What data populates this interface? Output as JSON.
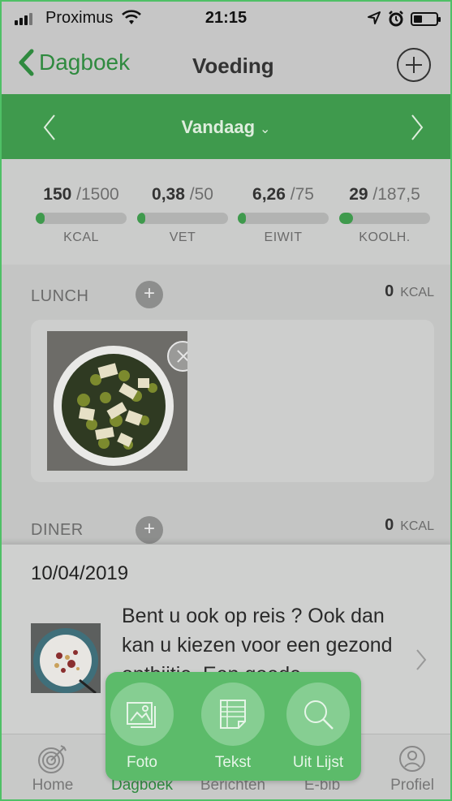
{
  "status_bar": {
    "carrier": "Proximus",
    "time": "21:15"
  },
  "nav": {
    "back_label": "Dagboek",
    "title": "Voeding"
  },
  "date_bar": {
    "label": "Vandaag"
  },
  "summary": [
    {
      "value": "150",
      "total": "/1500",
      "unit": "KCAL",
      "progress": 0.1
    },
    {
      "value": "0,38",
      "total": "/50",
      "unit": "VET",
      "progress": 0.01
    },
    {
      "value": "6,26",
      "total": "/75",
      "unit": "EIWIT",
      "progress": 0.08
    },
    {
      "value": "29",
      "total": "/187,5",
      "unit": "KOOLH.",
      "progress": 0.155
    }
  ],
  "meals": [
    {
      "name": "LUNCH",
      "kcal": "0",
      "unit": "KCAL"
    },
    {
      "name": "DINER",
      "kcal": "0",
      "unit": "KCAL"
    }
  ],
  "news": {
    "date": "10/04/2019",
    "text": "Bent u ook op reis ? Ook dan kan u kiezen voor een gezond ontbijtje. Een goede"
  },
  "popup_actions": [
    {
      "label": "Foto",
      "icon": "photo-icon"
    },
    {
      "label": "Tekst",
      "icon": "text-note-icon"
    },
    {
      "label": "Uit Lijst",
      "icon": "search-icon"
    }
  ],
  "tabs": [
    {
      "label": "Home",
      "icon": "target-icon"
    },
    {
      "label": "Dagboek",
      "icon": "diary-icon"
    },
    {
      "label": "Berichten",
      "icon": "messages-icon"
    },
    {
      "label": "E-bib",
      "icon": "library-icon"
    },
    {
      "label": "Profiel",
      "icon": "profile-icon"
    }
  ],
  "colors": {
    "brand_green": "#3f9a4d",
    "popup_green": "#5cbb6a",
    "link_green": "#2f8a3f"
  }
}
